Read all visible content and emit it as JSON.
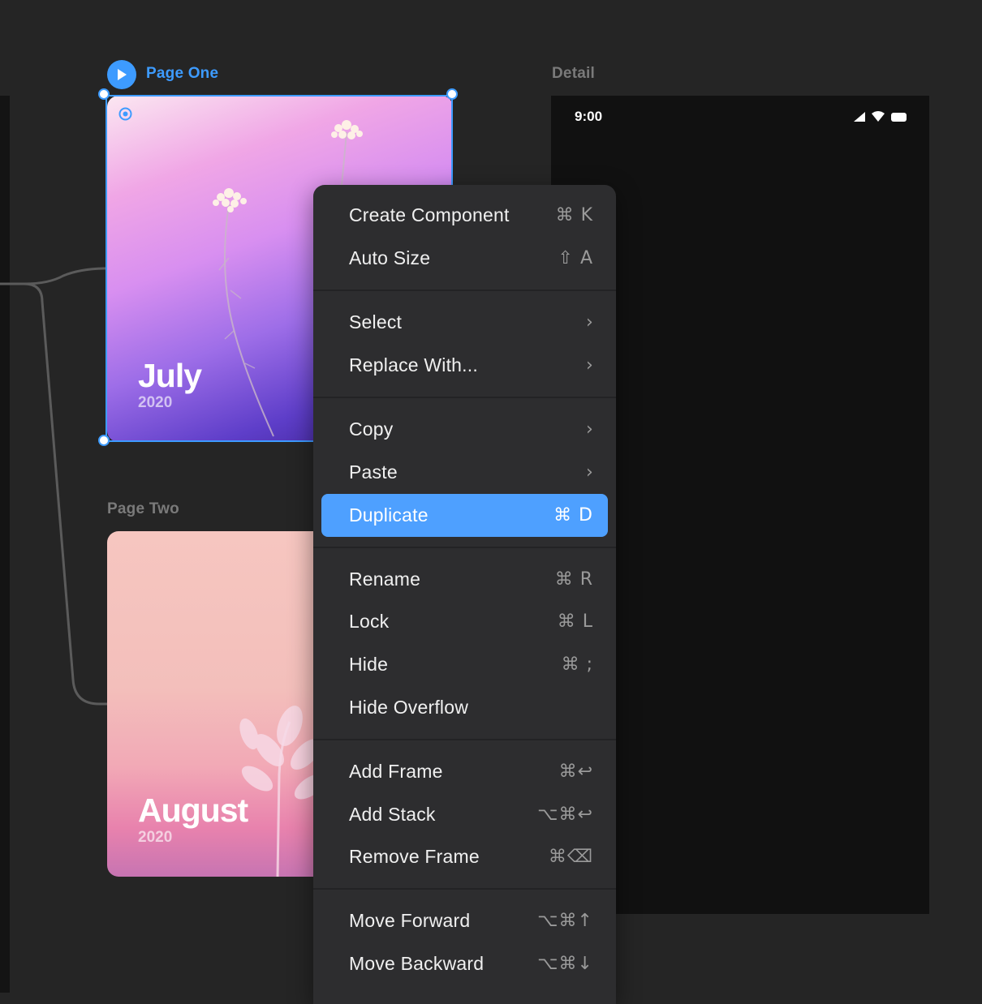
{
  "canvas": {
    "frames": {
      "page_one": {
        "label": "Page One",
        "card_title": "July",
        "card_year": "2020"
      },
      "page_two": {
        "label": "Page Two",
        "card_title": "August",
        "card_year": "2020"
      },
      "detail": {
        "label": "Detail",
        "status_time": "9:00"
      }
    }
  },
  "menu": {
    "items": [
      {
        "label": "Create Component",
        "shortcut": "⌘ K",
        "submenu": false,
        "highlight": false
      },
      {
        "label": "Auto Size",
        "shortcut": "⇧ A",
        "submenu": false,
        "highlight": false
      },
      {
        "label": "Select",
        "shortcut": "",
        "submenu": true,
        "highlight": false
      },
      {
        "label": "Replace With...",
        "shortcut": "",
        "submenu": true,
        "highlight": false
      },
      {
        "label": "Copy",
        "shortcut": "",
        "submenu": true,
        "highlight": false
      },
      {
        "label": "Paste",
        "shortcut": "",
        "submenu": true,
        "highlight": false
      },
      {
        "label": "Duplicate",
        "shortcut": "⌘ D",
        "submenu": false,
        "highlight": true
      },
      {
        "label": "Rename",
        "shortcut": "⌘ R",
        "submenu": false,
        "highlight": false
      },
      {
        "label": "Lock",
        "shortcut": "⌘ L",
        "submenu": false,
        "highlight": false
      },
      {
        "label": "Hide",
        "shortcut": "⌘ ;",
        "submenu": false,
        "highlight": false
      },
      {
        "label": "Hide Overflow",
        "shortcut": "",
        "submenu": false,
        "highlight": false
      },
      {
        "label": "Add Frame",
        "shortcut": "⌘↩",
        "submenu": false,
        "highlight": false
      },
      {
        "label": "Add Stack",
        "shortcut": "⌥⌘↩",
        "submenu": false,
        "highlight": false
      },
      {
        "label": "Remove Frame",
        "shortcut": "⌘⌫",
        "submenu": false,
        "highlight": false
      },
      {
        "label": "Move Forward",
        "shortcut": "⌥⌘↑",
        "submenu": false,
        "highlight": false
      },
      {
        "label": "Move Backward",
        "shortcut": "⌥⌘↓",
        "submenu": false,
        "highlight": false
      }
    ]
  },
  "colors": {
    "canvas_bg": "#252525",
    "accent": "#3d9bff",
    "menu_bg": "#2d2d2f",
    "menu_highlight": "#4ea0ff"
  }
}
